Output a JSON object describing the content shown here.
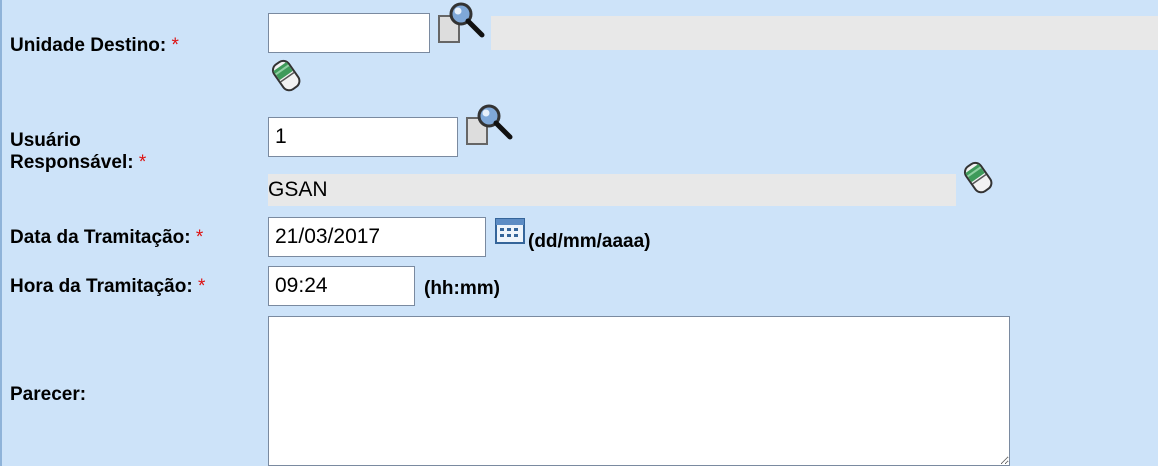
{
  "form": {
    "unidade_destino": {
      "label": "Unidade Destino:",
      "required": "*",
      "code": "",
      "description": ""
    },
    "usuario": {
      "label_line1": "Usuário",
      "label_line2": "Responsável:",
      "required": "*",
      "code": "1",
      "name": "GSAN"
    },
    "data": {
      "label": "Data da Tramitação:",
      "required": "*",
      "value": "21/03/2017",
      "format": "(dd/mm/aaaa)"
    },
    "hora": {
      "label": "Hora da Tramitação:",
      "required": "*",
      "value": "09:24",
      "format": "(hh:mm)"
    },
    "parecer": {
      "label": "Parecer:",
      "value": ""
    }
  },
  "icons": {
    "search": "magnifier-search-icon",
    "eraser": "eraser-clear-icon",
    "calendar": "calendar-icon"
  },
  "colors": {
    "background": "#cde3f9",
    "required": "#d11111",
    "readonly": "#e8e8e8"
  }
}
